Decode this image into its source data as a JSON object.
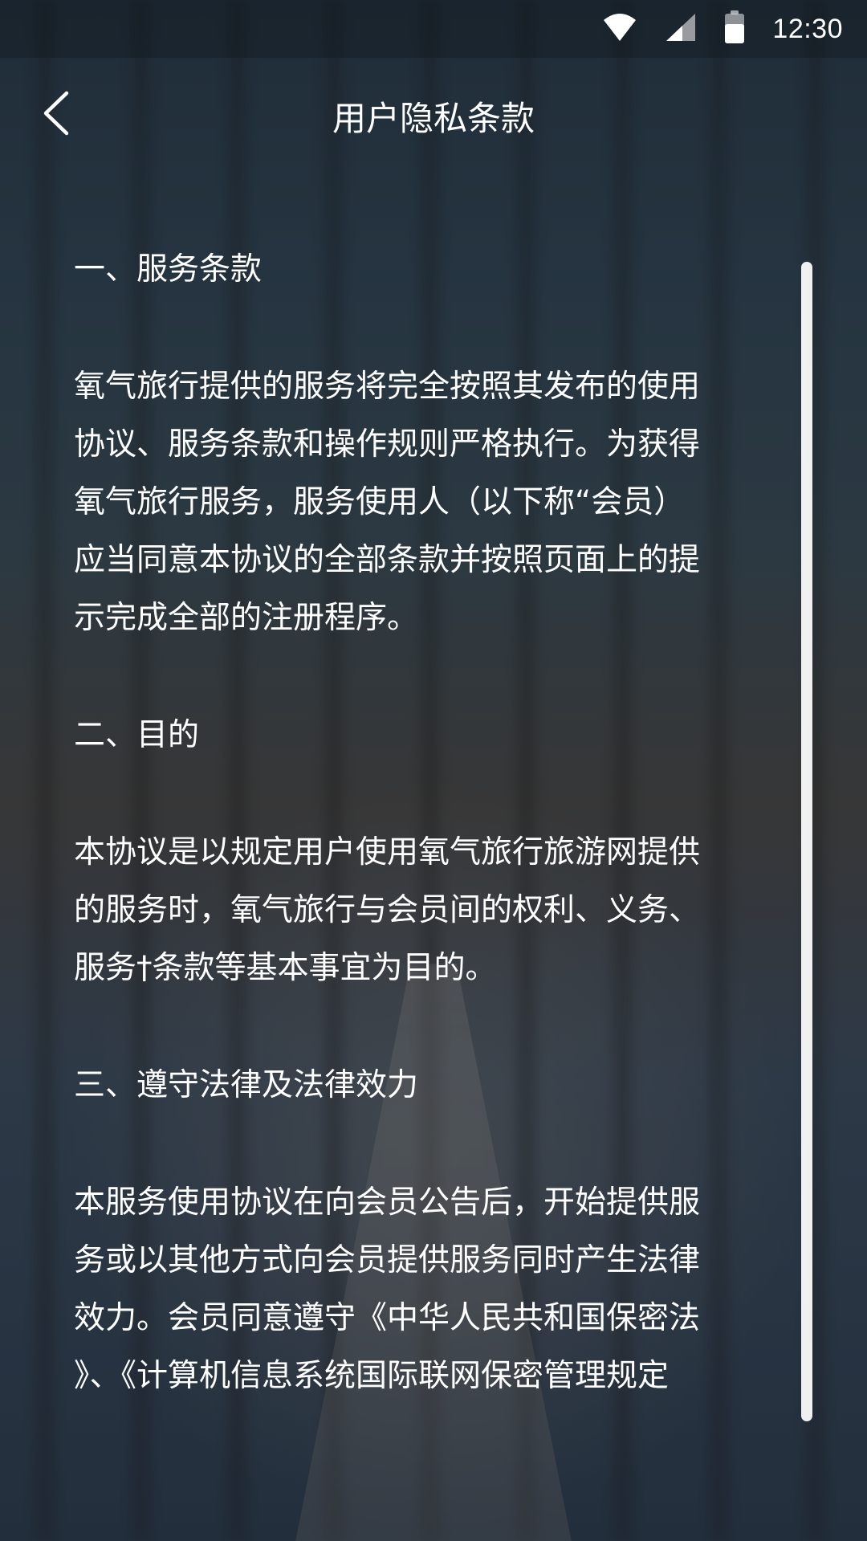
{
  "status_bar": {
    "time": "12:30",
    "icons": [
      "wifi-icon",
      "signal-icon",
      "battery-icon"
    ]
  },
  "navbar": {
    "back_icon": "chevron-left-icon",
    "title": "用户隐私条款"
  },
  "content": {
    "sections": [
      {
        "heading": "一、服务条款",
        "lines": [
          "氧气旅行提供的服务将完全按照其发布的使用",
          "协议、服务条款和操作规则严格执行。为获得",
          "氧气旅行服务，服务使用人（以下称“会员）",
          "应当同意本协议的全部条款并按照页面上的提",
          "示完成全部的注册程序。"
        ]
      },
      {
        "heading": "二、目的",
        "lines": [
          "本协议是以规定用户使用氧气旅行旅游网提供",
          "的服务时，氧气旅行与会员间的权利、义务、",
          "服务†条款等基本事宜为目的。"
        ]
      },
      {
        "heading": "三、遵守法律及法律效力",
        "lines": [
          "本服务使用协议在向会员公告后，开始提供服",
          "务或以其他方式向会员提供服务同时产生法律",
          "效力。会员同意遵守《中华人民共和国保密法",
          "》、《计算机信息系统国际联网保密管理规定"
        ]
      }
    ]
  },
  "colors": {
    "text": "#ffffff",
    "scroll_thumb": "#ffffff"
  }
}
